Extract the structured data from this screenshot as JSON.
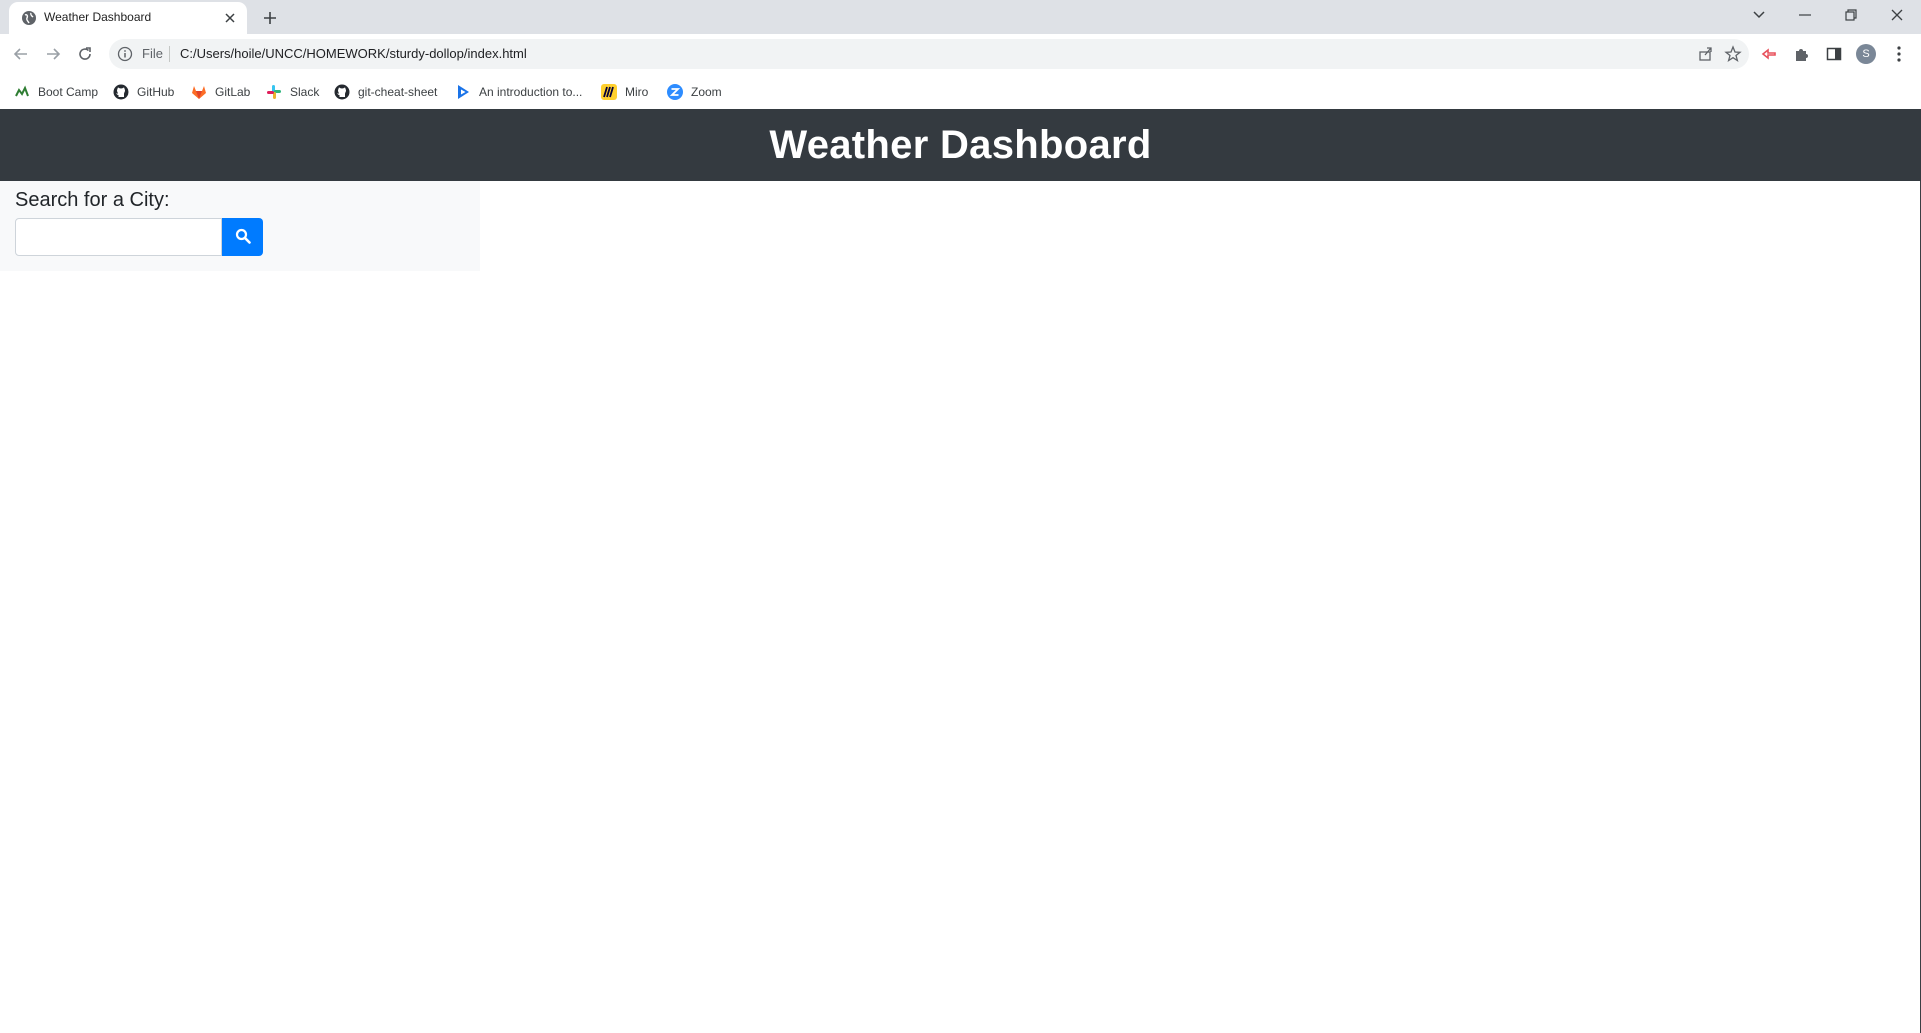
{
  "browser": {
    "tab": {
      "title": "Weather Dashboard",
      "favicon": "globe-icon"
    },
    "address": {
      "scheme_label": "File",
      "url": "C:/Users/hoile/UNCC/HOMEWORK/sturdy-dollop/index.html"
    },
    "profile_initial": "S",
    "bookmarks": [
      {
        "label": "Boot Camp",
        "icon": "bootcamp-icon",
        "color": "#2e7d32"
      },
      {
        "label": "GitHub",
        "icon": "github-icon",
        "color": "#24292f"
      },
      {
        "label": "GitLab",
        "icon": "gitlab-icon",
        "color": "#fc6d26"
      },
      {
        "label": "Slack",
        "icon": "slack-icon",
        "color": "#e01e5a"
      },
      {
        "label": "git-cheat-sheet",
        "icon": "github-icon",
        "color": "#24292f"
      },
      {
        "label": "An introduction to...",
        "icon": "play-icon",
        "color": "#1a73e8"
      },
      {
        "label": "Miro",
        "icon": "miro-icon",
        "color": "#ffd02f"
      },
      {
        "label": "Zoom",
        "icon": "zoom-icon",
        "color": "#2d8cff"
      }
    ]
  },
  "page": {
    "header": {
      "title": "Weather Dashboard",
      "background": "#343a40"
    },
    "search": {
      "label": "Search for a City:",
      "input_value": "",
      "placeholder": "",
      "button_icon": "search-icon",
      "button_color": "#007bff"
    }
  }
}
